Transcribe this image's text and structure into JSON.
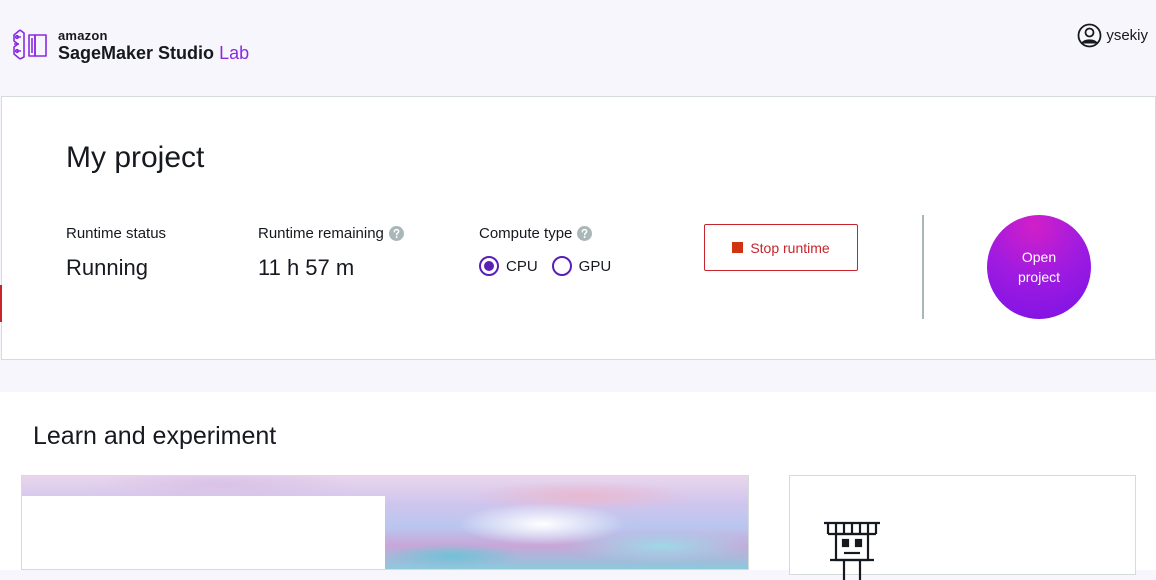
{
  "header": {
    "brand": "amazon",
    "product": "SageMaker Studio",
    "product_suffix": "Lab",
    "logo_icon": "studio-lab-logo-icon",
    "user": {
      "icon": "user-avatar-icon",
      "name": "ysekiy"
    }
  },
  "project": {
    "title": "My project",
    "runtime_status": {
      "label": "Runtime status",
      "value": "Running"
    },
    "runtime_remaining": {
      "label": "Runtime remaining",
      "value": "11 h 57 m",
      "help_icon": "help-circle-icon"
    },
    "compute_type": {
      "label": "Compute type",
      "help_icon": "help-circle-icon",
      "options": [
        {
          "label": "CPU",
          "selected": true
        },
        {
          "label": "GPU",
          "selected": false
        }
      ]
    },
    "stop_button": {
      "label": "Stop runtime",
      "icon": "stop-square-icon"
    },
    "open_button": {
      "label": "Open project"
    }
  },
  "learn": {
    "title": "Learn and experiment",
    "robot_icon": "robot-icon"
  },
  "colors": {
    "accent_purple": "#5a1fb5",
    "lab_purple": "#8a2be2",
    "stop_red": "#c7242b",
    "open_gradient_start": "#d21fc8",
    "open_gradient_end": "#7a12e6",
    "page_background": "#f7f6fc"
  }
}
